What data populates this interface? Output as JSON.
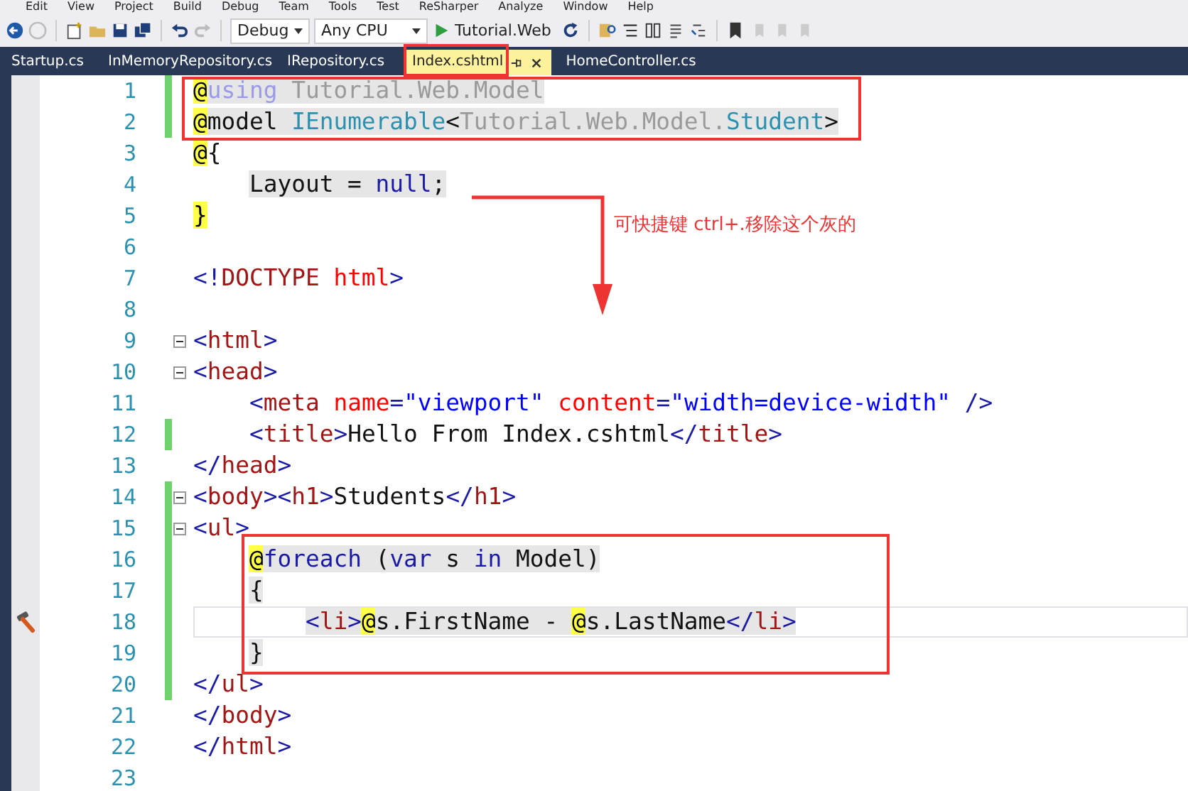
{
  "menu": [
    "Edit",
    "View",
    "Project",
    "Build",
    "Debug",
    "Team",
    "Tools",
    "Test",
    "ReSharper",
    "Analyze",
    "Window",
    "Help"
  ],
  "toolbar": {
    "configuration": "Debug",
    "platform": "Any CPU",
    "start_target": "Tutorial.Web"
  },
  "tabs": [
    {
      "label": "Startup.cs",
      "selected": false
    },
    {
      "label": "InMemoryRepository.cs",
      "selected": false
    },
    {
      "label": "IRepository.cs",
      "selected": false
    },
    {
      "label": "Index.cshtml",
      "selected": true
    },
    {
      "label": "HomeController.cs",
      "selected": false
    }
  ],
  "lines": [
    {
      "number": "1",
      "changed": true,
      "fold": false,
      "razor": true,
      "current": false,
      "hammer": false,
      "tokens": [
        {
          "kind": "at",
          "text": "@"
        },
        {
          "kind": "dimkw",
          "text": "using"
        },
        {
          "kind": "dim",
          "text": " Tutorial.Web.Model"
        }
      ]
    },
    {
      "number": "2",
      "changed": true,
      "fold": false,
      "razor": true,
      "current": false,
      "hammer": false,
      "tokens": [
        {
          "kind": "at",
          "text": "@"
        },
        {
          "kind": "plain",
          "text": "model "
        },
        {
          "kind": "type",
          "text": "IEnumerable"
        },
        {
          "kind": "plain",
          "text": "<"
        },
        {
          "kind": "dim",
          "text": "Tutorial.Web.Model."
        },
        {
          "kind": "type",
          "text": "Student"
        },
        {
          "kind": "plain",
          "text": ">"
        }
      ]
    },
    {
      "number": "3",
      "changed": false,
      "fold": false,
      "razor": false,
      "current": false,
      "hammer": false,
      "tokens": [
        {
          "kind": "at",
          "text": "@"
        },
        {
          "kind": "plain",
          "text": "{"
        }
      ]
    },
    {
      "number": "4",
      "changed": false,
      "fold": false,
      "razor": true,
      "current": false,
      "hammer": false,
      "tokens": [
        {
          "kind": "plain",
          "text": "    Layout = "
        },
        {
          "kind": "kw",
          "text": "null"
        },
        {
          "kind": "plain",
          "text": ";"
        }
      ]
    },
    {
      "number": "5",
      "changed": false,
      "fold": false,
      "razor": false,
      "current": false,
      "hammer": false,
      "tokens": [
        {
          "kind": "at",
          "text": "}"
        }
      ]
    },
    {
      "number": "6",
      "changed": false,
      "fold": false,
      "razor": false,
      "current": false,
      "hammer": false
    },
    {
      "number": "7",
      "changed": false,
      "fold": false,
      "razor": false,
      "current": false,
      "hammer": false,
      "tokens": [
        {
          "kind": "bracket",
          "text": "<!"
        },
        {
          "kind": "tag",
          "text": "DOCTYPE"
        },
        {
          "kind": "attr",
          "text": " html"
        },
        {
          "kind": "bracket",
          "text": ">"
        }
      ]
    },
    {
      "number": "8",
      "changed": false,
      "fold": false,
      "razor": false,
      "current": false,
      "hammer": false
    },
    {
      "number": "9",
      "changed": false,
      "fold": true,
      "razor": false,
      "current": false,
      "hammer": false,
      "tokens": [
        {
          "kind": "bracket",
          "text": "<"
        },
        {
          "kind": "tag",
          "text": "html"
        },
        {
          "kind": "bracket",
          "text": ">"
        }
      ]
    },
    {
      "number": "10",
      "changed": false,
      "fold": true,
      "razor": false,
      "current": false,
      "hammer": false,
      "tokens": [
        {
          "kind": "bracket",
          "text": "<"
        },
        {
          "kind": "tag",
          "text": "head"
        },
        {
          "kind": "bracket",
          "text": ">"
        }
      ]
    },
    {
      "number": "11",
      "changed": false,
      "fold": false,
      "razor": false,
      "current": false,
      "hammer": false,
      "tokens": [
        {
          "kind": "bracket",
          "text": "    <"
        },
        {
          "kind": "tag",
          "text": "meta"
        },
        {
          "kind": "attr",
          "text": " name"
        },
        {
          "kind": "bracket",
          "text": "="
        },
        {
          "kind": "str",
          "text": "\"viewport\""
        },
        {
          "kind": "attr",
          "text": " content"
        },
        {
          "kind": "bracket",
          "text": "="
        },
        {
          "kind": "str",
          "text": "\"width=device-width\""
        },
        {
          "kind": "bracket",
          "text": " />"
        }
      ]
    },
    {
      "number": "12",
      "changed": true,
      "fold": false,
      "razor": false,
      "current": false,
      "hammer": false,
      "tokens": [
        {
          "kind": "bracket",
          "text": "    <"
        },
        {
          "kind": "tag",
          "text": "title"
        },
        {
          "kind": "bracket",
          "text": ">"
        },
        {
          "kind": "plain",
          "text": "Hello From Index.cshtml"
        },
        {
          "kind": "bracket",
          "text": "</"
        },
        {
          "kind": "tag",
          "text": "title"
        },
        {
          "kind": "bracket",
          "text": ">"
        }
      ]
    },
    {
      "number": "13",
      "changed": false,
      "fold": false,
      "razor": false,
      "current": false,
      "hammer": false,
      "tokens": [
        {
          "kind": "bracket",
          "text": "</"
        },
        {
          "kind": "tag",
          "text": "head"
        },
        {
          "kind": "bracket",
          "text": ">"
        }
      ]
    },
    {
      "number": "14",
      "changed": true,
      "fold": true,
      "razor": false,
      "current": false,
      "hammer": false,
      "tokens": [
        {
          "kind": "bracket",
          "text": "<"
        },
        {
          "kind": "tag",
          "text": "body"
        },
        {
          "kind": "bracket",
          "text": "><"
        },
        {
          "kind": "tag",
          "text": "h1"
        },
        {
          "kind": "bracket",
          "text": ">"
        },
        {
          "kind": "plain",
          "text": "Students"
        },
        {
          "kind": "bracket",
          "text": "</"
        },
        {
          "kind": "tag",
          "text": "h1"
        },
        {
          "kind": "bracket",
          "text": ">"
        }
      ]
    },
    {
      "number": "15",
      "changed": true,
      "fold": true,
      "razor": false,
      "current": false,
      "hammer": false,
      "tokens": [
        {
          "kind": "bracket",
          "text": "<"
        },
        {
          "kind": "tag",
          "text": "ul"
        },
        {
          "kind": "bracket",
          "text": ">"
        }
      ]
    },
    {
      "number": "16",
      "changed": true,
      "fold": false,
      "razor": true,
      "current": false,
      "hammer": false,
      "tokens": [
        {
          "kind": "at",
          "text": "    @"
        },
        {
          "kind": "kw",
          "text": "foreach"
        },
        {
          "kind": "plain",
          "text": " ("
        },
        {
          "kind": "kw",
          "text": "var"
        },
        {
          "kind": "plain",
          "text": " s "
        },
        {
          "kind": "kw",
          "text": "in"
        },
        {
          "kind": "plain",
          "text": " Model)"
        }
      ]
    },
    {
      "number": "17",
      "changed": true,
      "fold": false,
      "razor": true,
      "current": false,
      "hammer": false,
      "tokens": [
        {
          "kind": "plain",
          "text": "    {"
        }
      ]
    },
    {
      "number": "18",
      "changed": true,
      "fold": false,
      "razor": true,
      "current": true,
      "hammer": true,
      "tokens": [
        {
          "kind": "bracket",
          "text": "        <"
        },
        {
          "kind": "tag",
          "text": "li"
        },
        {
          "kind": "bracket",
          "text": ">"
        },
        {
          "kind": "at",
          "text": "@"
        },
        {
          "kind": "plain",
          "text": "s.FirstName - "
        },
        {
          "kind": "at",
          "text": "@"
        },
        {
          "kind": "plain",
          "text": "s.LastName"
        },
        {
          "kind": "bracket",
          "text": "</"
        },
        {
          "kind": "tag",
          "text": "li"
        },
        {
          "kind": "bracket",
          "text": ">"
        }
      ]
    },
    {
      "number": "19",
      "changed": true,
      "fold": false,
      "razor": true,
      "current": false,
      "hammer": false,
      "tokens": [
        {
          "kind": "plain",
          "text": "    }"
        }
      ]
    },
    {
      "number": "20",
      "changed": true,
      "fold": false,
      "razor": false,
      "current": false,
      "hammer": false,
      "tokens": [
        {
          "kind": "bracket",
          "text": "</"
        },
        {
          "kind": "tag",
          "text": "ul"
        },
        {
          "kind": "bracket",
          "text": ">"
        }
      ]
    },
    {
      "number": "21",
      "changed": false,
      "fold": false,
      "razor": false,
      "current": false,
      "hammer": false,
      "tokens": [
        {
          "kind": "bracket",
          "text": "</"
        },
        {
          "kind": "tag",
          "text": "body"
        },
        {
          "kind": "bracket",
          "text": ">"
        }
      ]
    },
    {
      "number": "22",
      "changed": false,
      "fold": false,
      "razor": false,
      "current": false,
      "hammer": false,
      "tokens": [
        {
          "kind": "bracket",
          "text": "</"
        },
        {
          "kind": "tag",
          "text": "html"
        },
        {
          "kind": "bracket",
          "text": ">"
        }
      ]
    },
    {
      "number": "23",
      "changed": false,
      "fold": false,
      "razor": false,
      "current": false,
      "hammer": false
    }
  ],
  "annotation": {
    "note": "可快捷键  ctrl+.移除这个灰的"
  }
}
